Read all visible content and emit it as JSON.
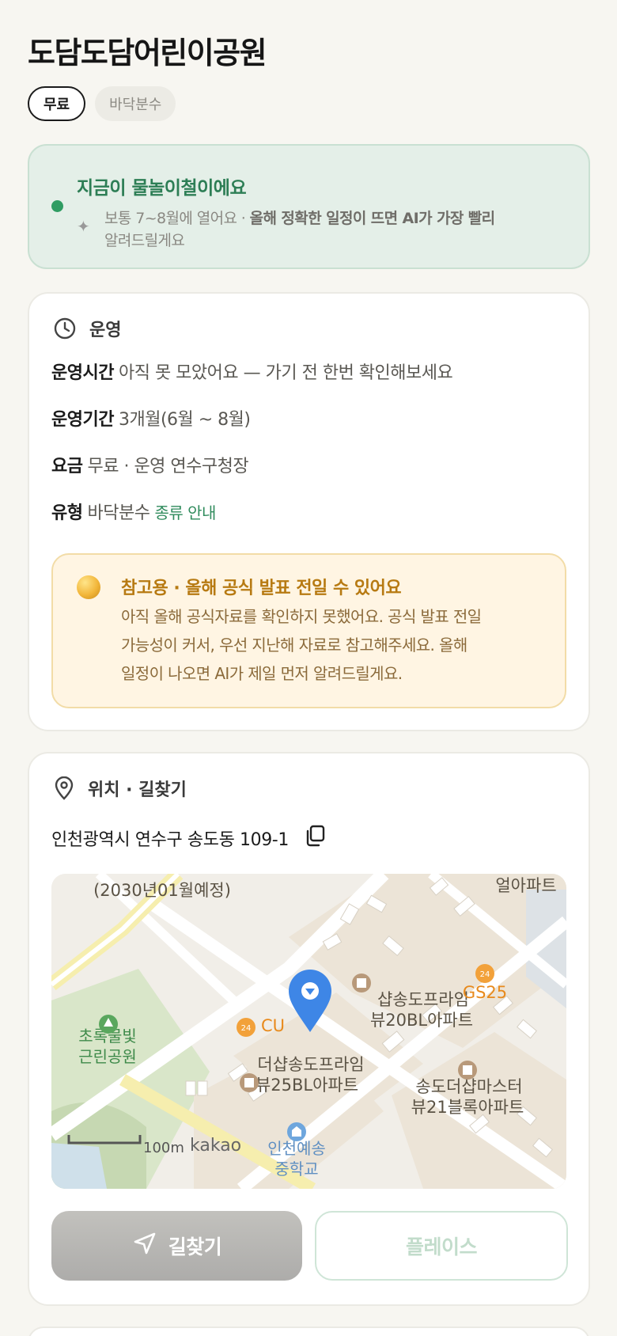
{
  "place": {
    "title": "도담도담어린이공원",
    "chips": [
      "무료",
      "바닥분수"
    ]
  },
  "season": {
    "status": "지금이 물놀이철이에요",
    "desc_plain": "보통 7~8월에 열어요 · ",
    "desc_bold": "올해 정확한 일정이 뜨면 AI가 가장 빨리",
    "desc_tail": "알려드릴게요",
    "accent": "#2f9c62"
  },
  "operation": {
    "section_title": "운영",
    "icon": "clock-icon",
    "rows": [
      {
        "key": "운영시간",
        "value": "아직 못 모았어요 — 가기 전 한번 확인해보세요"
      },
      {
        "key": "운영기간",
        "value": "3개월(6월 ~ 8월)"
      },
      {
        "key": "요금",
        "value": "무료 · 운영 연수구청장"
      },
      {
        "key": "유형",
        "value": "바닥분수",
        "link": "종류 안내"
      }
    ],
    "notice": {
      "title": "참고용 · 올해 공식 발표 전일 수 있어요",
      "lines": [
        "아직 올해 공식자료를 확인하지 못했어요. 공식 발표 전일",
        "가능성이 커서, 우선 지난해 자료로 참고해주세요. 올해",
        "일정이 나오면 AI가 제일 먼저 알려드릴게요."
      ]
    }
  },
  "location": {
    "section_title": "위치 · 길찾기",
    "icon": "map-pin-icon",
    "address": "인천광역시 연수구 송도동 109-1",
    "copy_icon": "copy-icon",
    "map": {
      "labels": {
        "top_left": "(2030년01월예정)",
        "top_right": "얼아파트",
        "gs25": "GS25",
        "cu": "CU",
        "apt1_l1": "샵송도프라임",
        "apt1_l2": "뷰20BL아파트",
        "park_l1": "초록물빛",
        "park_l2": "근린공원",
        "apt2_l1": "더샵송도프라임",
        "apt2_l2": "뷰25BL아파트",
        "apt3_l1": "송도더샵마스터",
        "apt3_l2": "뷰21블록아파트",
        "school_l1": "인천예송",
        "school_l2": "중학교",
        "scale": "100m",
        "brand": "kakao"
      }
    },
    "buttons": {
      "navigate": "길찾기",
      "place": "플레이스"
    }
  }
}
